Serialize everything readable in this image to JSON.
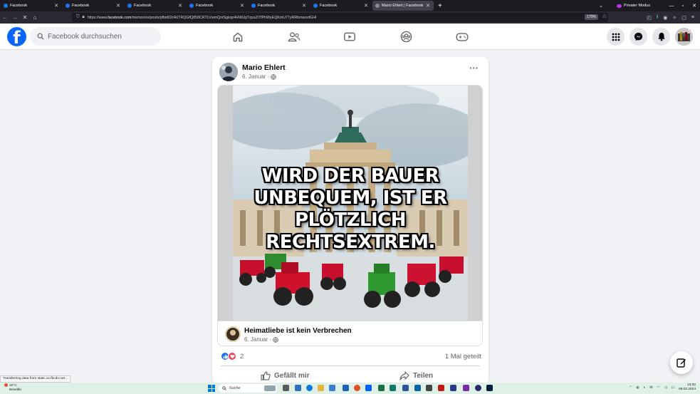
{
  "browser": {
    "tabs": [
      {
        "title": "Facebook",
        "active": false
      },
      {
        "title": "Facebook",
        "active": false
      },
      {
        "title": "Facebook",
        "active": false
      },
      {
        "title": "Facebook",
        "active": false
      },
      {
        "title": "Facebook",
        "active": false
      },
      {
        "title": "Facebook",
        "active": false
      },
      {
        "title": "Mario Ehlert | Facebook",
        "active": true
      }
    ],
    "new_tab": "+",
    "private_label": "Privater Modus",
    "url_prefix": "https://www.",
    "url_domain": "facebook.com",
    "url_rest": "/memorios/posts/pfbid02rA6TRQGfQ858CRTLVwmQntSgkqo4HWUpTqssZi7fPhWyEQKmU77yRRbmwvsfGHl",
    "zoom": "170%"
  },
  "facebook": {
    "search_placeholder": "Facebook durchsuchen",
    "post": {
      "author": "Mario Ehlert",
      "date": "6. Januar",
      "image_text": "WIRD DER BAUER UNBEQUEM, IST ER PLÖTZLICH RECHTSEXTREM.",
      "shared_from": {
        "name": "Heimatliebe ist kein Verbrechen",
        "date": "6. Januar"
      },
      "reaction_count": "2",
      "share_count": "1 Mal geteilt",
      "like_label": "Gefällt mir",
      "share_label": "Teilen"
    }
  },
  "status_bar": "Transferring data from static.xx.fbcdn.net...",
  "taskbar": {
    "weather_temp": "10°C",
    "weather_desc": "Bewölkt",
    "search_label": "Suche",
    "time": "13:32",
    "date": "09.02.2024"
  },
  "colors": {
    "facebook_blue": "#0866ff",
    "like_blue": "#1877f2",
    "love_red": "#f33e58",
    "firefox_dark": "#1c1b22",
    "taskbar": "#dff0e7"
  }
}
